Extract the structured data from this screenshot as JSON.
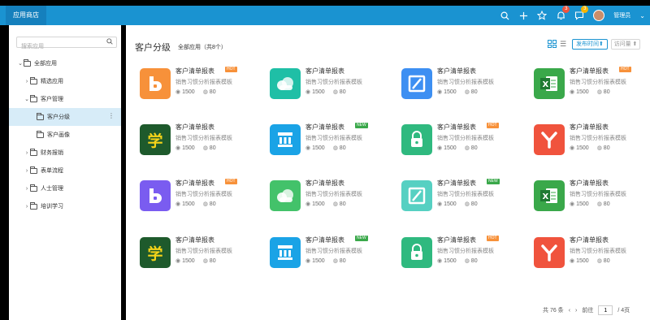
{
  "topbar": {
    "tab_label": "应用商店",
    "notif_count": "3",
    "msg_count": "3",
    "user_name": "管理员"
  },
  "sidebar": {
    "search_placeholder": "搜索应用",
    "items": [
      {
        "label": "全部应用",
        "caret": "⌄",
        "indent": 0
      },
      {
        "label": "精选应用",
        "caret": "›",
        "indent": 1
      },
      {
        "label": "客户管理",
        "caret": "⌄",
        "indent": 1
      },
      {
        "label": "客户分级",
        "caret": "",
        "indent": 2,
        "selected": true
      },
      {
        "label": "客户画像",
        "caret": "",
        "indent": 2
      },
      {
        "label": "财务报销",
        "caret": "›",
        "indent": 1
      },
      {
        "label": "表单流程",
        "caret": "›",
        "indent": 1
      },
      {
        "label": "人士管理",
        "caret": "›",
        "indent": 1
      },
      {
        "label": "培训学习",
        "caret": "›",
        "indent": 1
      }
    ]
  },
  "main": {
    "title": "客户分级",
    "subtitle": "全部应用（共8个）",
    "sort_label": "发布时间⬆",
    "sort2_label": "访问量 ⬆"
  },
  "cards": [
    {
      "title": "客户清单报表",
      "desc": "销售习惯分析报表模板",
      "views": "1500",
      "comments": "80",
      "badge": "HOT",
      "icon": "b",
      "color": "#f7913a"
    },
    {
      "title": "客户清单报表",
      "desc": "销售习惯分析报表模板",
      "views": "1500",
      "comments": "80",
      "badge": "",
      "icon": "cloud",
      "color": "#1fbfa6"
    },
    {
      "title": "客户清单报表",
      "desc": "销售习惯分析报表模板",
      "views": "1500",
      "comments": "80",
      "badge": "",
      "icon": "Z",
      "color": "#3d8ff2"
    },
    {
      "title": "客户清单报表",
      "desc": "销售习惯分析报表模板",
      "views": "1500",
      "comments": "80",
      "badge": "HOT",
      "icon": "X",
      "color": "#3aa84a"
    },
    {
      "title": "客户清单报表",
      "desc": "销售习惯分析报表模板",
      "views": "1500",
      "comments": "80",
      "badge": "",
      "icon": "学",
      "color": "#1e5a2c"
    },
    {
      "title": "客户清单报表",
      "desc": "销售习惯分析报表模板",
      "views": "1500",
      "comments": "80",
      "badge": "NEW",
      "icon": "bank",
      "color": "#1aa3e6"
    },
    {
      "title": "客户清单报表",
      "desc": "销售习惯分析报表模板",
      "views": "1500",
      "comments": "80",
      "badge": "HOT",
      "icon": "lock",
      "color": "#2fb97f"
    },
    {
      "title": "客户清单报表",
      "desc": "销售习惯分析报表模板",
      "views": "1500",
      "comments": "80",
      "badge": "",
      "icon": "Y",
      "color": "#f0533d"
    },
    {
      "title": "客户清单报表",
      "desc": "销售习惯分析报表模板",
      "views": "1500",
      "comments": "80",
      "badge": "HOT",
      "icon": "b",
      "color": "#7a5cf0"
    },
    {
      "title": "客户清单报表",
      "desc": "销售习惯分析报表模板",
      "views": "1500",
      "comments": "80",
      "badge": "",
      "icon": "cloud",
      "color": "#43c26a"
    },
    {
      "title": "客户清单报表",
      "desc": "销售习惯分析报表模板",
      "views": "1500",
      "comments": "80",
      "badge": "NEW",
      "icon": "Z",
      "color": "#56d0c2"
    },
    {
      "title": "客户清单报表",
      "desc": "销售习惯分析报表模板",
      "views": "1500",
      "comments": "80",
      "badge": "",
      "icon": "X",
      "color": "#3aa84a"
    },
    {
      "title": "客户清单报表",
      "desc": "销售习惯分析报表模板",
      "views": "1500",
      "comments": "80",
      "badge": "",
      "icon": "学",
      "color": "#1e5a2c"
    },
    {
      "title": "客户清单报表",
      "desc": "销售习惯分析报表模板",
      "views": "1500",
      "comments": "80",
      "badge": "NEW",
      "icon": "bank",
      "color": "#1aa3e6"
    },
    {
      "title": "客户清单报表",
      "desc": "销售习惯分析报表模板",
      "views": "1500",
      "comments": "80",
      "badge": "HOT",
      "icon": "lock",
      "color": "#2fb97f"
    },
    {
      "title": "客户清单报表",
      "desc": "销售习惯分析报表模板",
      "views": "1500",
      "comments": "80",
      "badge": "",
      "icon": "Y",
      "color": "#f0533d"
    }
  ],
  "pager": {
    "total": "共 76 条",
    "goto": "前往",
    "page": "1",
    "pages": "/ 4页"
  },
  "colors": {
    "accent": "#1a93d1",
    "hot": "#f7913a",
    "new": "#3aa84a"
  }
}
